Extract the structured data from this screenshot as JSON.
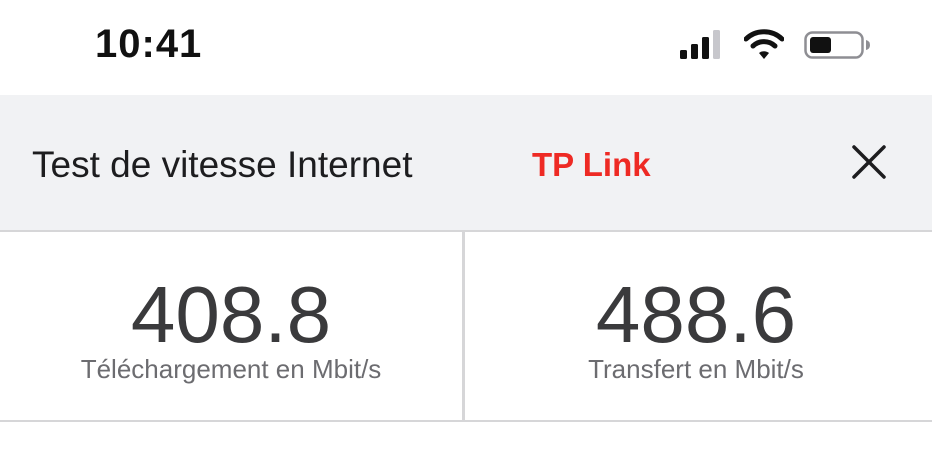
{
  "status_bar": {
    "time": "10:41",
    "icons": [
      "cellular-signal-icon",
      "wifi-icon",
      "battery-icon"
    ]
  },
  "header": {
    "title": "Test de vitesse Internet",
    "brand": "TP Link",
    "brand_color": "#ee2a24",
    "close_icon": "close-icon"
  },
  "results": {
    "download": {
      "value": "408.8",
      "label": "Téléchargement en Mbit/s"
    },
    "upload": {
      "value": "488.6",
      "label": "Transfert en Mbit/s"
    }
  }
}
